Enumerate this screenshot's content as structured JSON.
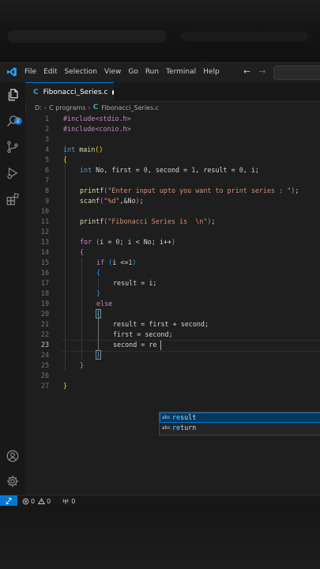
{
  "menubar": {
    "items": [
      "File",
      "Edit",
      "Selection",
      "View",
      "Go",
      "Run",
      "Terminal",
      "Help"
    ],
    "back_arrow": "←",
    "forward_arrow": "→"
  },
  "activity_bar": {
    "explorer_badge": "2",
    "icons": [
      "files-icon",
      "search-icon",
      "source-control-icon",
      "run-debug-icon",
      "extensions-icon",
      "account-icon",
      "settings-gear-icon"
    ]
  },
  "tab": {
    "icon": "C",
    "label": "Fibonacci_Series.c"
  },
  "breadcrumb": {
    "drive": "D:",
    "folder": "C programs",
    "file_icon": "C",
    "file": "Fibonacci_Series.c"
  },
  "editor": {
    "line_numbers": [
      "1",
      "2",
      "3",
      "4",
      "5",
      "6",
      "7",
      "8",
      "9",
      "10",
      "11",
      "12",
      "13",
      "14",
      "15",
      "16",
      "17",
      "18",
      "19",
      "20",
      "21",
      "22",
      "23",
      "24",
      "25",
      "26",
      "27"
    ],
    "active_line": "23",
    "code": {
      "l1": "#include<stdio.h>",
      "l2": "#include<conio.h>",
      "l4_kw": "int",
      "l4_fn": "main",
      "l4_parens": "()",
      "l5": "{",
      "l6_kw": "int",
      "l6_a": " No, first = ",
      "l6_n1": "0",
      "l6_b": ", second = ",
      "l6_n2": "1",
      "l6_c": ", result = ",
      "l6_n3": "0",
      "l6_d": ", i;",
      "l8_fn": "printf",
      "l8_open": "(",
      "l8_str": "\"Enter input upto you want to print series : \"",
      "l8_close": ")",
      "l8_end": ";",
      "l9_fn": "scanf",
      "l9_open": "(",
      "l9_str": "\"%d\"",
      "l9_mid": ",&No",
      "l9_close": ")",
      "l9_end": ";",
      "l11_fn": "printf",
      "l11_open": "(",
      "l11_str": "\"Fibonacci Series is  \\n\"",
      "l11_close": ")",
      "l11_end": ";",
      "l13_kw": "for",
      "l13_open": "(",
      "l13_a": "i = ",
      "l13_n": "0",
      "l13_b": "; i < No; i++",
      "l13_close": ")",
      "l14": "{",
      "l15_kw": "if",
      "l15_open": "(",
      "l15_a": "i <=",
      "l15_n": "1",
      "l15_close": ")",
      "l16": "{",
      "l17": "result = i;",
      "l18": "}",
      "l19_kw": "else",
      "l20": "{",
      "l21": "result = first + second;",
      "l22": "first = second;",
      "l23": "second = re",
      "l24": "}",
      "l25": "}",
      "l27": "}"
    }
  },
  "suggestions": {
    "kind_label": "abc",
    "items": [
      {
        "match": "re",
        "rest": "sult"
      },
      {
        "match": "re",
        "rest": "turn"
      }
    ]
  },
  "statusbar": {
    "errors": "0",
    "warnings": "0",
    "ports": "0"
  },
  "colors": {
    "accent": "#0078d4",
    "editor_bg": "#1e1e1e",
    "keyword": "#569cd6",
    "preprocessor": "#c586c0",
    "function": "#dcdcaa",
    "string": "#ce9178",
    "number": "#b5cea8"
  }
}
